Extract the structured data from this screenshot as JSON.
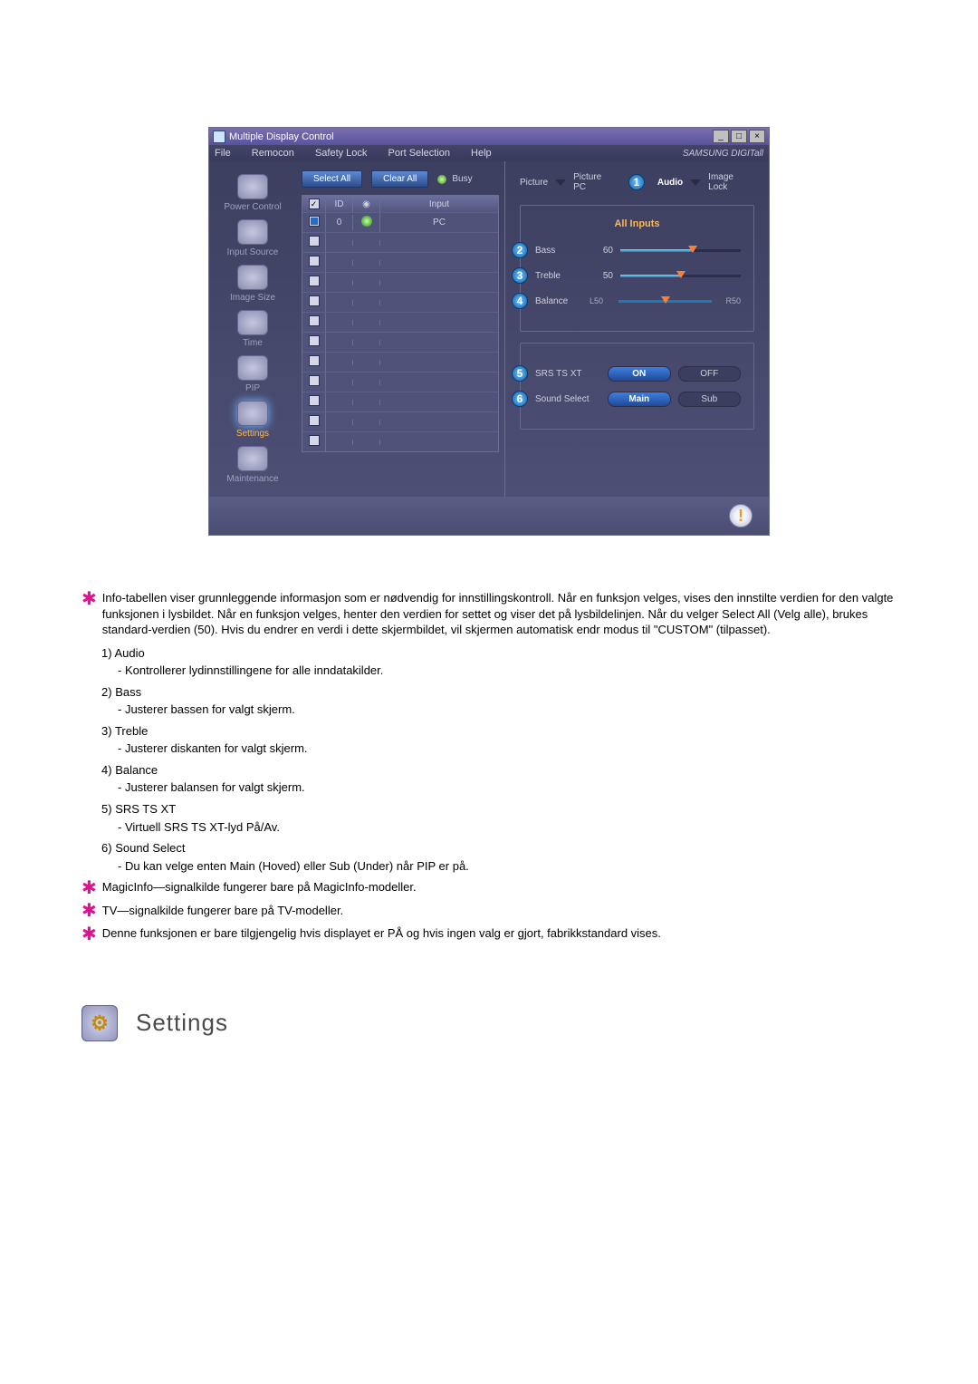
{
  "window": {
    "title": "Multiple Display Control",
    "brand": "SAMSUNG DIGITall"
  },
  "menubar": [
    "File",
    "Remocon",
    "Safety Lock",
    "Port Selection",
    "Help"
  ],
  "sidebar": [
    {
      "label": "Power Control"
    },
    {
      "label": "Input Source"
    },
    {
      "label": "Image Size"
    },
    {
      "label": "Time"
    },
    {
      "label": "PIP"
    },
    {
      "label": "Settings",
      "active": true
    },
    {
      "label": "Maintenance"
    }
  ],
  "center": {
    "select_all": "Select All",
    "clear_all": "Clear All",
    "busy": "Busy",
    "headers": {
      "id": "ID",
      "input": "Input"
    },
    "rows": [
      {
        "checked": true,
        "id": "0",
        "status": true,
        "input": "PC"
      }
    ],
    "blank_rows": 10
  },
  "tabs": [
    {
      "label": "Picture"
    },
    {
      "label": "Picture PC"
    },
    {
      "label": "Audio",
      "active": true,
      "callout": "1"
    },
    {
      "label": "Image Lock"
    }
  ],
  "audio": {
    "header": "All Inputs",
    "sliders": [
      {
        "callout": "2",
        "label": "Bass",
        "value": "60",
        "pct": 60
      },
      {
        "callout": "3",
        "label": "Treble",
        "value": "50",
        "pct": 50
      },
      {
        "callout": "4",
        "label": "Balance",
        "left": "L50",
        "right": "R50",
        "pct": 50
      }
    ],
    "options": [
      {
        "callout": "5",
        "label": "SRS TS XT",
        "a": "ON",
        "b": "OFF",
        "sel": 0
      },
      {
        "callout": "6",
        "label": "Sound Select",
        "a": "Main",
        "b": "Sub",
        "sel": 0
      }
    ]
  },
  "desc": {
    "intro": "Info-tabellen viser grunnleggende informasjon som er nødvendig for innstillingskontroll. Når en funksjon velges, vises den innstilte verdien for den valgte funksjonen i lysbildet. Når en funksjon velges, henter den verdien for settet og viser det på lysbildelinjen. Når du velger Select All (Velg alle), brukes standard-verdien (50). Hvis du endrer en verdi i dette skjermbildet, vil skjermen automatisk endr modus til \"CUSTOM\" (tilpasset).",
    "items": [
      {
        "n": "1)",
        "t": "Audio",
        "s": "- Kontrollerer lydinnstillingene for alle inndatakilder."
      },
      {
        "n": "2)",
        "t": "Bass",
        "s": "- Justerer bassen for valgt skjerm."
      },
      {
        "n": "3)",
        "t": "Treble",
        "s": "- Justerer diskanten for valgt skjerm."
      },
      {
        "n": "4)",
        "t": "Balance",
        "s": "- Justerer balansen for valgt skjerm."
      },
      {
        "n": "5)",
        "t": "SRS TS XT",
        "s": "- Virtuell SRS TS XT-lyd På/Av."
      },
      {
        "n": "6)",
        "t": "Sound Select",
        "s": "- Du kan velge enten Main (Hoved) eller Sub (Under) når PIP er på."
      }
    ],
    "notes": [
      "MagicInfo—signalkilde fungerer bare på MagicInfo-modeller.",
      "TV—signalkilde fungerer bare på TV-modeller.",
      "Denne funksjonen er bare tilgjengelig hvis displayet er PÅ og hvis ingen valg er gjort, fabrikkstandard vises."
    ]
  },
  "section": {
    "title": "Settings"
  }
}
